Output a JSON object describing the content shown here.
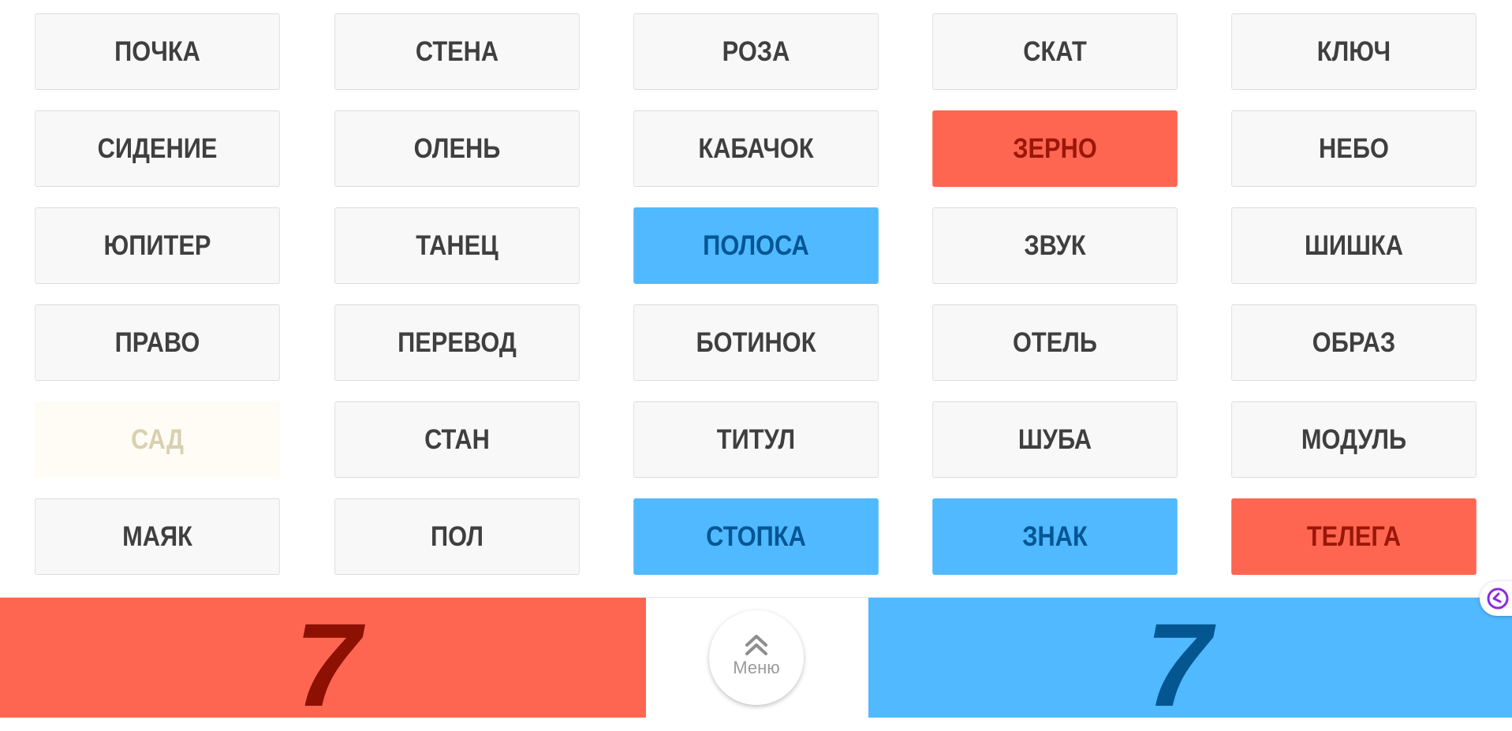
{
  "board": {
    "cards": [
      {
        "word": "ПОЧКА",
        "state": "hidden"
      },
      {
        "word": "СТЕНА",
        "state": "hidden"
      },
      {
        "word": "РОЗА",
        "state": "hidden"
      },
      {
        "word": "СКАТ",
        "state": "hidden"
      },
      {
        "word": "КЛЮЧ",
        "state": "hidden"
      },
      {
        "word": "СИДЕНИЕ",
        "state": "hidden"
      },
      {
        "word": "ОЛЕНЬ",
        "state": "hidden"
      },
      {
        "word": "КАБАЧОК",
        "state": "hidden"
      },
      {
        "word": "ЗЕРНО",
        "state": "red"
      },
      {
        "word": "НЕБО",
        "state": "hidden"
      },
      {
        "word": "ЮПИТЕР",
        "state": "hidden"
      },
      {
        "word": "ТАНЕЦ",
        "state": "hidden"
      },
      {
        "word": "ПОЛОСА",
        "state": "blue"
      },
      {
        "word": "ЗВУК",
        "state": "hidden"
      },
      {
        "word": "ШИШКА",
        "state": "hidden"
      },
      {
        "word": "ПРАВО",
        "state": "hidden"
      },
      {
        "word": "ПЕРЕВОД",
        "state": "hidden"
      },
      {
        "word": "БОТИНОК",
        "state": "hidden"
      },
      {
        "word": "ОТЕЛЬ",
        "state": "hidden"
      },
      {
        "word": "ОБРАЗ",
        "state": "hidden"
      },
      {
        "word": "САД",
        "state": "neutral"
      },
      {
        "word": "СТАН",
        "state": "hidden"
      },
      {
        "word": "ТИТУЛ",
        "state": "hidden"
      },
      {
        "word": "ШУБА",
        "state": "hidden"
      },
      {
        "word": "МОДУЛЬ",
        "state": "hidden"
      },
      {
        "word": "МАЯК",
        "state": "hidden"
      },
      {
        "word": "ПОЛ",
        "state": "hidden"
      },
      {
        "word": "СТОПКА",
        "state": "blue"
      },
      {
        "word": "ЗНАК",
        "state": "blue"
      },
      {
        "word": "ТЕЛЕГА",
        "state": "red"
      }
    ]
  },
  "scores": {
    "red": "7",
    "blue": "7"
  },
  "menu": {
    "label": "Меню",
    "icon": "double-chevron-up-icon"
  },
  "side_widget": {
    "icon": "chat-widget-icon"
  },
  "colors": {
    "red_team": "#ff6651",
    "red_text": "#8c1103",
    "blue_team": "#51b9ff",
    "blue_text": "#03568f",
    "card_bg": "#f8f8f8",
    "card_text": "#3f3f3f",
    "neutral_bg": "#fefcf5",
    "neutral_text": "#d9d0b0"
  }
}
